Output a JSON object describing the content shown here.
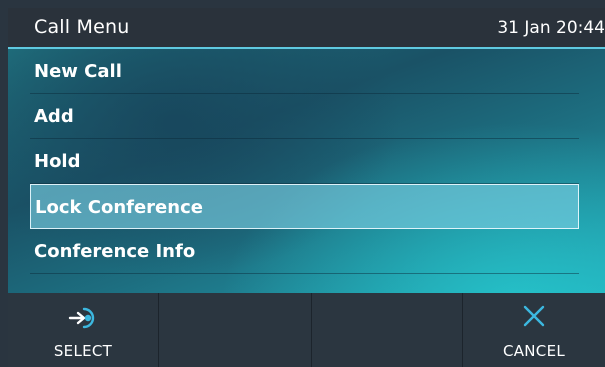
{
  "header": {
    "title": "Call Menu",
    "datetime": "31 Jan 20:44"
  },
  "menu": {
    "items": [
      {
        "label": "New Call",
        "selected": false
      },
      {
        "label": "Add",
        "selected": false
      },
      {
        "label": "Hold",
        "selected": false
      },
      {
        "label": "Lock Conference",
        "selected": true
      },
      {
        "label": "Conference Info",
        "selected": false
      }
    ]
  },
  "softkeys": [
    {
      "label": "SELECT",
      "icon": "select-arrow-icon"
    },
    {
      "label": "",
      "icon": ""
    },
    {
      "label": "",
      "icon": ""
    },
    {
      "label": "CANCEL",
      "icon": "close-icon"
    }
  ],
  "colors": {
    "header_bg": "#2a323b",
    "softkey_bg": "#2b3640",
    "accent": "#3cb8e0",
    "text": "#ffffff"
  }
}
